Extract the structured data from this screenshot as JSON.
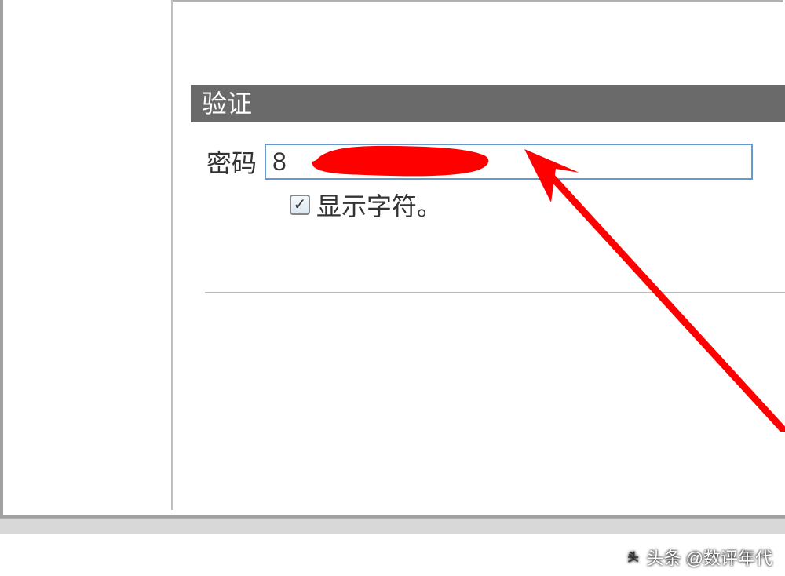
{
  "section": {
    "title": "验证"
  },
  "password": {
    "label": "密码",
    "value": "8"
  },
  "showChars": {
    "label": "显示字符。",
    "checked": true
  },
  "watermark": {
    "prefix": "头条",
    "handle": "@数评年代"
  }
}
